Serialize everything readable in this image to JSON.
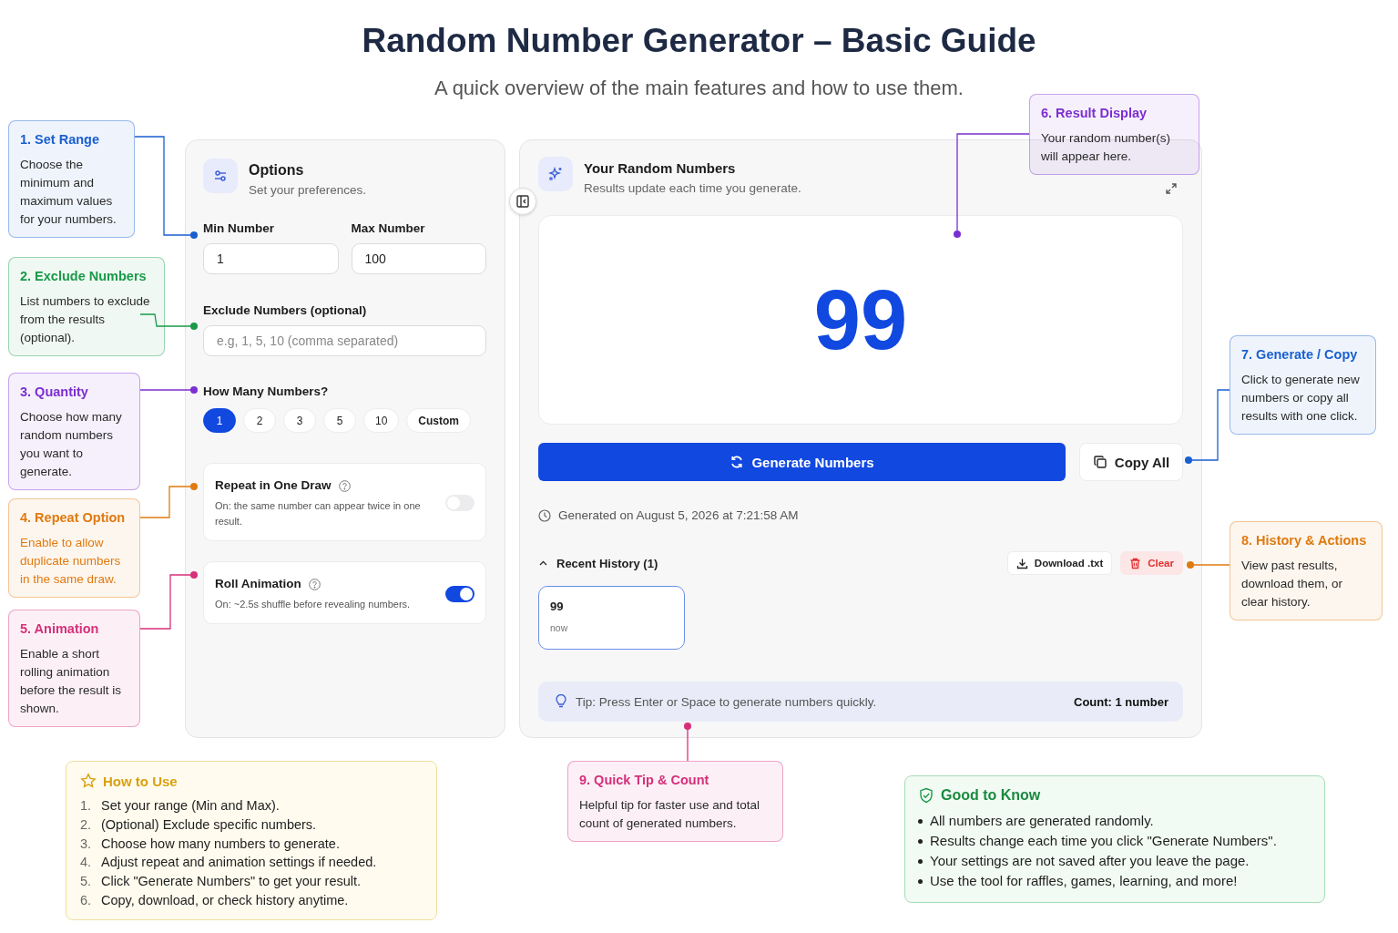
{
  "title": "Random Number Generator – Basic Guide",
  "subtitle": "A quick overview of the main features and how to use them.",
  "options": {
    "title": "Options",
    "subtitle": "Set your preferences.",
    "min": {
      "label": "Min Number",
      "value": "1"
    },
    "max": {
      "label": "Max Number",
      "value": "100"
    },
    "exclude": {
      "label": "Exclude Numbers (optional)",
      "placeholder": "e.g, 1, 5, 10 (comma separated)"
    },
    "quantity": {
      "label": "How Many Numbers?",
      "choices": [
        {
          "label": "1",
          "selected": true
        },
        {
          "label": "2",
          "selected": false
        },
        {
          "label": "3",
          "selected": false
        },
        {
          "label": "5",
          "selected": false
        },
        {
          "label": "10",
          "selected": false
        },
        {
          "label": "Custom",
          "selected": false
        }
      ]
    },
    "toggles": [
      {
        "title": "Repeat in One Draw",
        "description": "On: the same number can appear twice in one result.",
        "on": false
      },
      {
        "title": "Roll Animation",
        "description": "On: ~2.5s shuffle before revealing numbers.",
        "on": true
      }
    ]
  },
  "results": {
    "title": "Your Random Numbers",
    "subtitle": "Results update each time you generate.",
    "value": "99",
    "generate_button": "Generate Numbers",
    "copy_button": "Copy All",
    "timestamp": "Generated on August 5, 2026 at 7:21:58 AM",
    "history": {
      "title": "Recent History (1)",
      "expanded": true,
      "download_button": "Download .txt",
      "clear_button": "Clear",
      "items": [
        {
          "value": "99",
          "time": "now"
        }
      ]
    },
    "tip": "Tip: Press Enter or Space to generate numbers quickly.",
    "count": "Count: 1 number"
  },
  "callouts": [
    {
      "title": "1. Set Range",
      "body": "Choose the minimum and maximum values for your numbers.",
      "color": "#1a5fd0"
    },
    {
      "title": "2. Exclude Numbers",
      "body": "List numbers to exclude from the results (optional).",
      "color": "#1a9a4a"
    },
    {
      "title": "3. Quantity",
      "body": "Choose how many random numbers you want to generate.",
      "color": "#7b2fd0"
    },
    {
      "title": "4. Repeat Option",
      "body": "Enable to allow duplicate numbers in the same draw.",
      "color": "#e07a10"
    },
    {
      "title": "5. Animation",
      "body": "Enable a short rolling animation before the result is shown.",
      "color": "#d6307a"
    },
    {
      "title": "6. Result Display",
      "body": "Your random number(s) will appear here.",
      "color": "#7b2fd0"
    },
    {
      "title": "7. Generate / Copy",
      "body": "Click to generate new numbers or copy all results with one click.",
      "color": "#1a5fd0"
    },
    {
      "title": "8. History & Actions",
      "body": "View past results, download them, or clear history.",
      "color": "#e07a10"
    },
    {
      "title": "9. Quick Tip & Count",
      "body": "Helpful tip for faster use and total count of generated numbers.",
      "color": "#d6307a"
    }
  ],
  "how_to_use": {
    "title": "How to Use",
    "steps": [
      {
        "number": "1.",
        "text": "Set your range (Min and Max)."
      },
      {
        "number": "2.",
        "text": "(Optional) Exclude specific numbers."
      },
      {
        "number": "3.",
        "text": "Choose how many numbers to generate."
      },
      {
        "number": "4.",
        "text": "Adjust repeat and animation settings if needed."
      },
      {
        "number": "5.",
        "text": "Click \"Generate Numbers\" to get your result."
      },
      {
        "number": "6.",
        "text": "Copy, download, or check history anytime."
      }
    ]
  },
  "good_to_know": {
    "title": "Good to Know",
    "items": [
      "All numbers are generated randomly.",
      "Results change each time you click \"Generate Numbers\".",
      "Your settings are not saved after you leave the page.",
      "Use the tool for raffles, games, learning, and more!"
    ]
  }
}
